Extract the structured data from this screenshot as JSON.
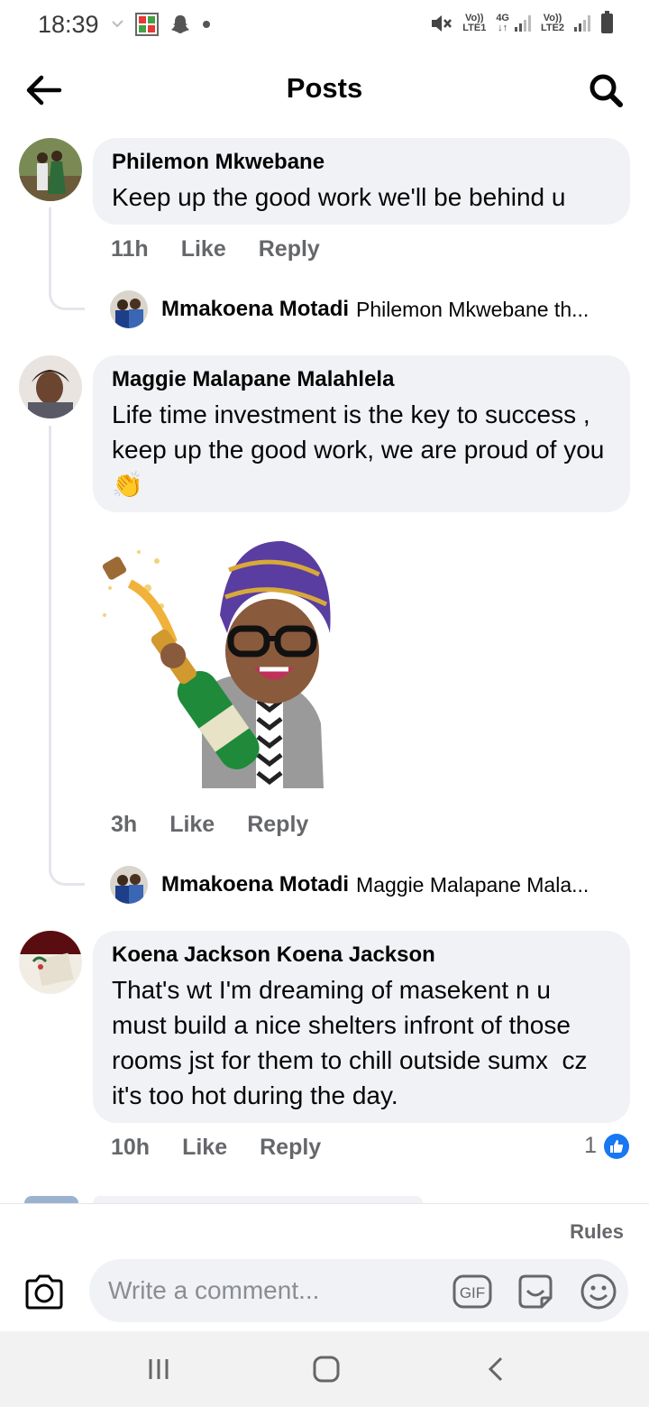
{
  "status_bar": {
    "time": "18:39",
    "sim1_label": "Vo)) LTE1",
    "network_type": "4G",
    "sim2_label": "Vo)) LTE2"
  },
  "header": {
    "title": "Posts",
    "back_icon": "arrow-left-icon",
    "search_icon": "search-icon"
  },
  "comments": [
    {
      "author": "Philemon Mkwebane",
      "text": "Keep up the good work we'll be behind u",
      "time": "11h",
      "like_label": "Like",
      "reply_label": "Reply",
      "reply_preview": {
        "author": "Mmakoena Motadi",
        "snippet": "Philemon Mkwebane th..."
      }
    },
    {
      "author": "Maggie Malapane Malahlela",
      "text": "Life time investment is the key to success , keep up the good work, we are proud of you 👏",
      "time": "3h",
      "like_label": "Like",
      "reply_label": "Reply",
      "sticker": "champagne-celebration-avatar-sticker",
      "reply_preview": {
        "author": "Mmakoena Motadi",
        "snippet": "Maggie Malapane Mala..."
      }
    },
    {
      "author": "Koena Jackson Koena Jackson",
      "text": "That's wt I'm dreaming of masekent n u must build a nice shelters infront of those rooms jst for them to chill outside sumx  cz it's too hot during the day.",
      "time": "10h",
      "like_label": "Like",
      "reply_label": "Reply",
      "reaction_count": "1",
      "reaction_icon": "thumbs-up-icon"
    }
  ],
  "composer": {
    "rules_label": "Rules",
    "placeholder": "Write a comment...",
    "gif_label": "GIF",
    "icons": [
      "camera-icon",
      "gif-icon",
      "sticker-icon",
      "emoji-icon"
    ]
  },
  "nav_bar": {
    "icons": [
      "recent-apps-icon",
      "home-icon",
      "back-icon"
    ]
  },
  "colors": {
    "bubble": "#f0f2f5",
    "secondary_text": "#65676b",
    "like_blue": "#1877f2"
  }
}
